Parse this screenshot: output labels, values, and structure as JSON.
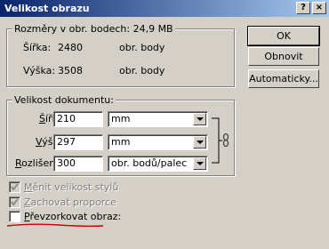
{
  "window": {
    "title": "Velikost obrazu",
    "help": "?",
    "close": "×"
  },
  "pixel_dims": {
    "legend": "Rozměry v obr. bodech: 24,9 MB",
    "width_label": "Šířka:",
    "width_value": "2480",
    "width_unit": "obr. body",
    "height_label": "Výška:",
    "height_value": "3508",
    "height_unit": "obr. body"
  },
  "doc_size": {
    "legend": "Velikost dokumentu:",
    "width_label_u": "Š",
    "width_label_rest": "ířka:",
    "width_value": "210",
    "width_unit": "mm",
    "height_label_u": "V",
    "height_label_rest": "ýška:",
    "height_value": "297",
    "height_unit": "mm",
    "res_label_u": "R",
    "res_label_rest": "ozlišení:",
    "res_value": "300",
    "res_unit": "obr. bodů/palec"
  },
  "buttons": {
    "ok": "OK",
    "reset": "Obnovit",
    "auto": "Automaticky..."
  },
  "options": {
    "scale_styles_u": "M",
    "scale_styles_rest": "ěnit velikost stylů",
    "constrain_u": "Z",
    "constrain_rest": "achovat proporce",
    "resample_u": "P",
    "resample_rest": "řevzorkovat obraz:"
  },
  "colors": {
    "title_start": "#0a246a",
    "title_end": "#a6caf0",
    "annotation": "#cc0000"
  }
}
